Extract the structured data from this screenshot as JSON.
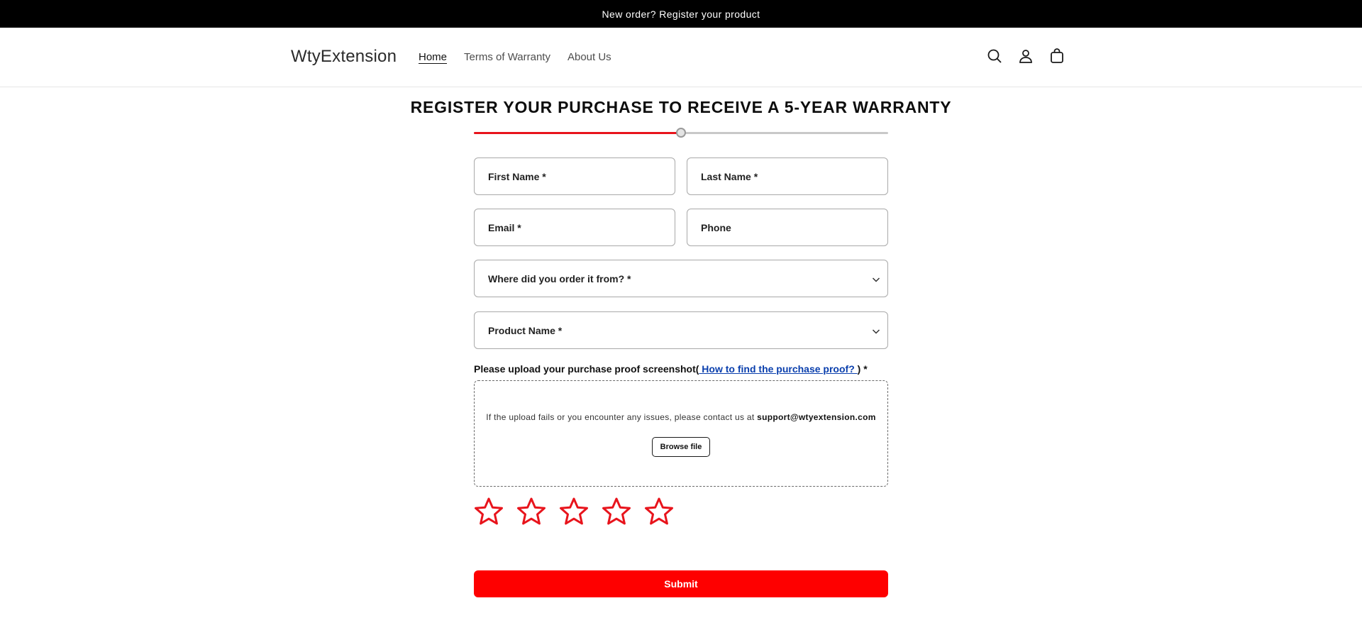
{
  "announcement": {
    "text": "New order? Register your product"
  },
  "header": {
    "logo": "WtyExtension",
    "nav": [
      {
        "label": "Home",
        "active": true
      },
      {
        "label": "Terms of Warranty",
        "active": false
      },
      {
        "label": "About Us",
        "active": false
      }
    ],
    "icons": [
      "search-icon",
      "account-icon",
      "cart-icon"
    ]
  },
  "form": {
    "title": "REGISTER YOUR PURCHASE TO RECEIVE A 5-YEAR WARRANTY",
    "progress": 0.5,
    "fields": {
      "first_name": "First Name *",
      "last_name": "Last Name *",
      "email": "Email *",
      "phone": "Phone",
      "order_source": "Where did you order it from? *",
      "product_name": "Product Name *"
    },
    "upload": {
      "label_prefix": "Please upload your purchase proof screenshot(",
      "link_text": " How to find the purchase proof? ",
      "label_suffix": ") *",
      "message": "If the upload fails or you encounter any issues, please contact us at ",
      "email": "support@wtyextension.com",
      "browse_label": "Browse file"
    },
    "rating": {
      "max": 5,
      "value": 0,
      "color": "#e8141c"
    },
    "submit_label": "Submit"
  },
  "colors": {
    "accent": "#fe0000",
    "announcement_bg": "#000000"
  }
}
